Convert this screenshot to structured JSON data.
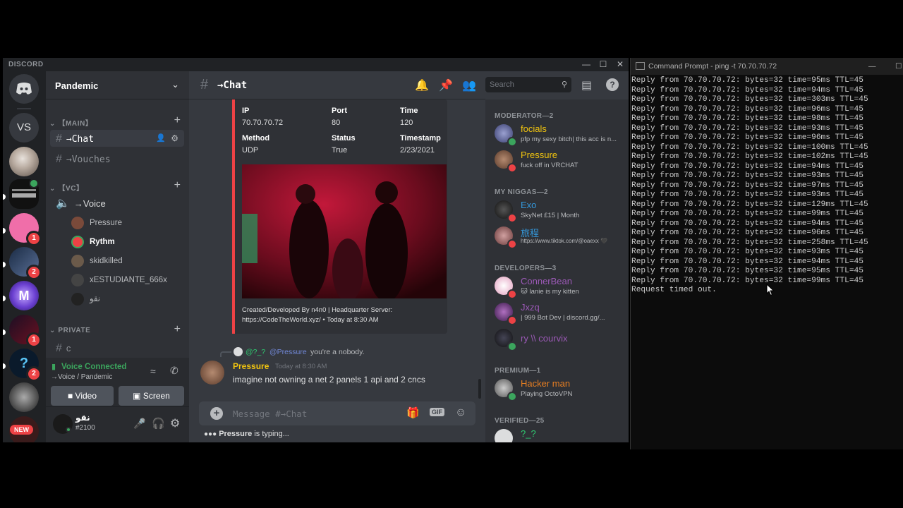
{
  "discord": {
    "brand": "DISCORD",
    "server_rail": {
      "initials": "VS",
      "badges": [
        "1",
        "2",
        "1",
        "2"
      ],
      "new_label": "NEW",
      "speaker_badge": "1"
    },
    "guild_name": "Pandemic",
    "categories": {
      "main": "【MAIN】",
      "vc": "【VC】",
      "private": "PRIVATE"
    },
    "channels": {
      "chat": "→Chat",
      "vouches": "→Vouches",
      "voice": "→Voice",
      "c": "c"
    },
    "voice_users": [
      "Pressure",
      "Rythm",
      "skidkilled",
      "xESTUDIANTE_666x",
      "نقو"
    ],
    "voice_status": {
      "title": "Voice Connected",
      "sub": "→Voice / Pandemic",
      "video_label": "Video",
      "screen_label": "Screen"
    },
    "user": {
      "name": "نقو",
      "tag": "#2100"
    },
    "chat_header": {
      "title": "→Chat",
      "search_placeholder": "Search"
    },
    "embed": {
      "fields": [
        {
          "name": "IP",
          "value": "70.70.70.72"
        },
        {
          "name": "Port",
          "value": "80"
        },
        {
          "name": "Time",
          "value": "120"
        },
        {
          "name": "Method",
          "value": "UDP"
        },
        {
          "name": "Status",
          "value": "True"
        },
        {
          "name": "Timestamp",
          "value": "2/23/2021"
        }
      ],
      "footer_line1": "Created/Developed By n4n0 | Headquarter Server:",
      "footer_line2": "https://CodeTheWorld.xyz/ • Today at 8:30 AM"
    },
    "message": {
      "reply_author": "@?_?",
      "reply_mention": "@Pressure",
      "reply_text": "you're a nobody.",
      "author": "Pressure",
      "timestamp": "Today at 8:30 AM",
      "text": "imagine not owning a net 2 panels 1 api and 2 cncs"
    },
    "composer": {
      "placeholder": "Message #→Chat",
      "gif_label": "GIF"
    },
    "typing": {
      "user": "Pressure",
      "text": " is typing..."
    },
    "members": {
      "groups": [
        {
          "title": "MODERATOR—2",
          "members": [
            {
              "name": "focials",
              "sub": "pfp my sexy bitch| this acc is n...",
              "color": "#f1c40f",
              "status": "#3ba55d"
            },
            {
              "name": "Pressure",
              "sub": "fuck off in VRCHAT",
              "color": "#f1c40f",
              "status": "#ed4245"
            }
          ]
        },
        {
          "title": "MY NIGGAS—2",
          "members": [
            {
              "name": "Exo",
              "sub": "SkyNet £15 | Month",
              "color": "#3498db",
              "status": "#ed4245"
            },
            {
              "name": "旅程",
              "sub": "https://www.tiktok.com/@oaexx 🖤",
              "color": "#3498db",
              "status": "#ed4245"
            }
          ]
        },
        {
          "title": "DEVELOPERS—3",
          "members": [
            {
              "name": "ConnerBean",
              "sub": "🐱 lanie is my kitten",
              "color": "#9b59b6",
              "status": "#ed4245"
            },
            {
              "name": "Jxzq",
              "sub": "| 999 Bot Dev | discord.gg/...",
              "color": "#9b59b6",
              "status": "#ed4245"
            },
            {
              "name": "ry \\\\ courvix",
              "sub": "",
              "color": "#9b59b6",
              "status": "#3ba55d"
            }
          ]
        },
        {
          "title": "PREMIUM—1",
          "members": [
            {
              "name": "Hacker man",
              "sub": "Playing OctoVPN",
              "color": "#e67e22",
              "status": "#3ba55d"
            }
          ]
        },
        {
          "title": "VERIFIED—25",
          "members": [
            {
              "name": "?_?",
              "sub": "",
              "color": "#2ecc71",
              "status": "#3ba55d"
            }
          ]
        }
      ]
    }
  },
  "cmd": {
    "title": "Command Prompt - ping  -t 70.70.70.72",
    "lines": [
      "Reply from 70.70.70.72: bytes=32 time=95ms TTL=45",
      "Reply from 70.70.70.72: bytes=32 time=94ms TTL=45",
      "Reply from 70.70.70.72: bytes=32 time=303ms TTL=45",
      "Reply from 70.70.70.72: bytes=32 time=96ms TTL=45",
      "Reply from 70.70.70.72: bytes=32 time=98ms TTL=45",
      "Reply from 70.70.70.72: bytes=32 time=93ms TTL=45",
      "Reply from 70.70.70.72: bytes=32 time=96ms TTL=45",
      "Reply from 70.70.70.72: bytes=32 time=100ms TTL=45",
      "Reply from 70.70.70.72: bytes=32 time=102ms TTL=45",
      "Reply from 70.70.70.72: bytes=32 time=94ms TTL=45",
      "Reply from 70.70.70.72: bytes=32 time=93ms TTL=45",
      "Reply from 70.70.70.72: bytes=32 time=97ms TTL=45",
      "Reply from 70.70.70.72: bytes=32 time=93ms TTL=45",
      "Reply from 70.70.70.72: bytes=32 time=129ms TTL=45",
      "Reply from 70.70.70.72: bytes=32 time=99ms TTL=45",
      "Reply from 70.70.70.72: bytes=32 time=94ms TTL=45",
      "Reply from 70.70.70.72: bytes=32 time=96ms TTL=45",
      "Reply from 70.70.70.72: bytes=32 time=258ms TTL=45",
      "Reply from 70.70.70.72: bytes=32 time=93ms TTL=45",
      "Reply from 70.70.70.72: bytes=32 time=94ms TTL=45",
      "Reply from 70.70.70.72: bytes=32 time=95ms TTL=45",
      "Reply from 70.70.70.72: bytes=32 time=99ms TTL=45",
      "Request timed out."
    ]
  }
}
